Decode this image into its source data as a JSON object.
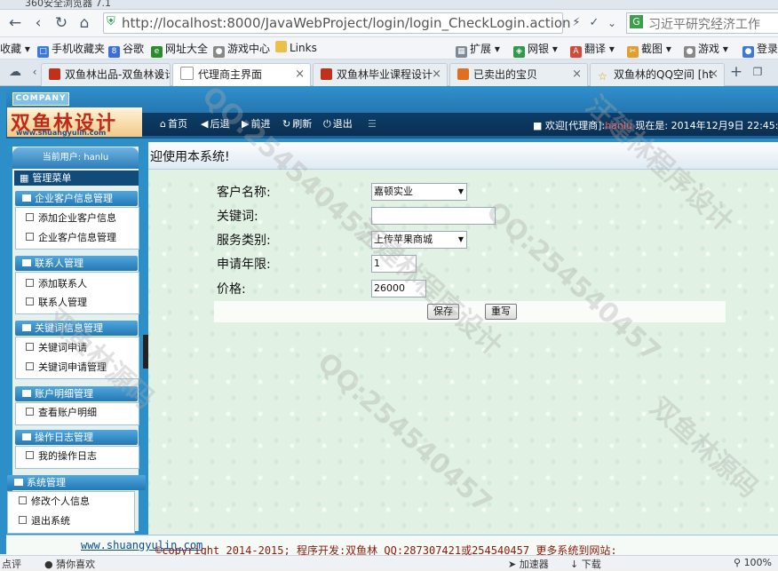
{
  "browser": {
    "window_title": "360安全浏览器 7.1",
    "address": "http://localhost:8000/JavaWebProject/login/login_CheckLogin.action",
    "search_text": "习近平研究经济工作",
    "bookmarks": [
      "收藏",
      "手机收藏夹",
      "谷歌",
      "网址大全",
      "游戏中心",
      "Links",
      "扩展",
      "网银",
      "翻译",
      "截图",
      "游戏",
      "登录"
    ],
    "tabs": [
      {
        "label": "双鱼林出品-双鱼林设计",
        "active": false
      },
      {
        "label": "代理商主界面",
        "active": true
      },
      {
        "label": "双鱼林毕业课程设计",
        "active": false
      },
      {
        "label": "已卖出的宝贝",
        "active": false
      },
      {
        "label": "双鱼林的QQ空间 [ht",
        "active": false
      }
    ],
    "status_left": [
      "点评",
      "猜你喜欢"
    ],
    "status_right": [
      "加速器",
      "下载",
      "100%"
    ]
  },
  "header": {
    "company": "COMPANY",
    "logo_text": "双鱼林设计",
    "logo_url": "www.shuangyulin.com",
    "menu": [
      "首页",
      "后退",
      "前进",
      "刷新",
      "退出"
    ],
    "welcome_prefix": "欢迎[代理商]:",
    "user": "hanlu",
    "time": "现在是: 2014年12月9日 22:45:"
  },
  "sidebar": {
    "current_user": "当前用户: hanlu",
    "title": "管理菜单",
    "sections": [
      {
        "title": "企业客户信息管理",
        "items": [
          "添加企业客户信息",
          "企业客户信息管理"
        ]
      },
      {
        "title": "联系人管理",
        "items": [
          "添加联系人",
          "联系人管理"
        ]
      },
      {
        "title": "关键词信息管理",
        "items": [
          "关键词申请",
          "关键词申请管理"
        ]
      },
      {
        "title": "账户明细管理",
        "items": [
          "查看账户明细"
        ]
      },
      {
        "title": "操作日志管理",
        "items": [
          "我的操作日志"
        ]
      },
      {
        "title": "系统管理",
        "items": [
          "修改个人信息",
          "退出系统"
        ]
      }
    ]
  },
  "main": {
    "greeting": "迎使用本系统!",
    "form": {
      "customer_label": "客户名称:",
      "customer_value": "嘉顿实业",
      "keyword_label": "关键词:",
      "keyword_value": "",
      "service_label": "服务类别:",
      "service_value": "上传苹果商城",
      "years_label": "申请年限:",
      "years_value": "1",
      "price_label": "价格:",
      "price_value": "26000",
      "save": "保存",
      "reset": "重写"
    }
  },
  "footer": {
    "copyright": "©copyright 2014-2015; 程序开发:双鱼林  QQ:287307421或254540457  更多系统到网站: ",
    "link": "www.shuangyulin.com"
  },
  "watermark": [
    "QQ:254540457",
    "汪建林程序设计",
    "双鱼林源码"
  ],
  "colors": {
    "frame_blue": "#2d8fc8",
    "menu_dark": "#0d3d68",
    "content_green": "#e1f2e4",
    "footer_red": "#8b1a0a"
  }
}
